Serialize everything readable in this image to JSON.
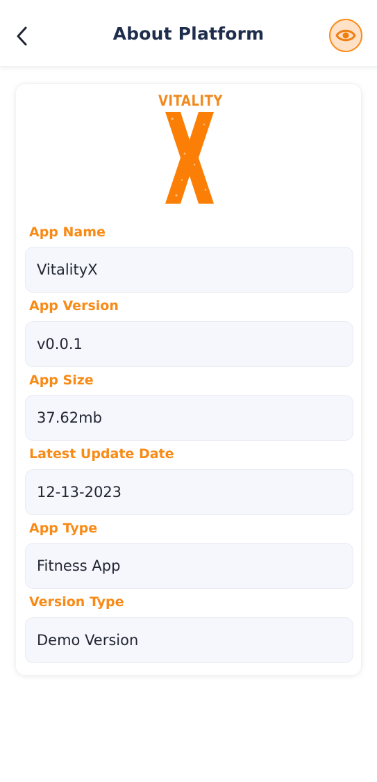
{
  "header": {
    "title": "About Platform",
    "back_icon": "chevron-left-icon",
    "eye_icon": "eye-icon",
    "accent_color": "#FB8C1A"
  },
  "logo": {
    "word": "VITALITY",
    "letter": "X"
  },
  "fields": [
    {
      "label": "App Name",
      "value": "VitalityX"
    },
    {
      "label": "App Version",
      "value": "v0.0.1"
    },
    {
      "label": "App Size",
      "value": "37.62mb"
    },
    {
      "label": "Latest Update Date",
      "value": "12-13-2023"
    },
    {
      "label": "App Type",
      "value": "Fitness App"
    },
    {
      "label": "Version Type",
      "value": "Demo Version"
    }
  ]
}
